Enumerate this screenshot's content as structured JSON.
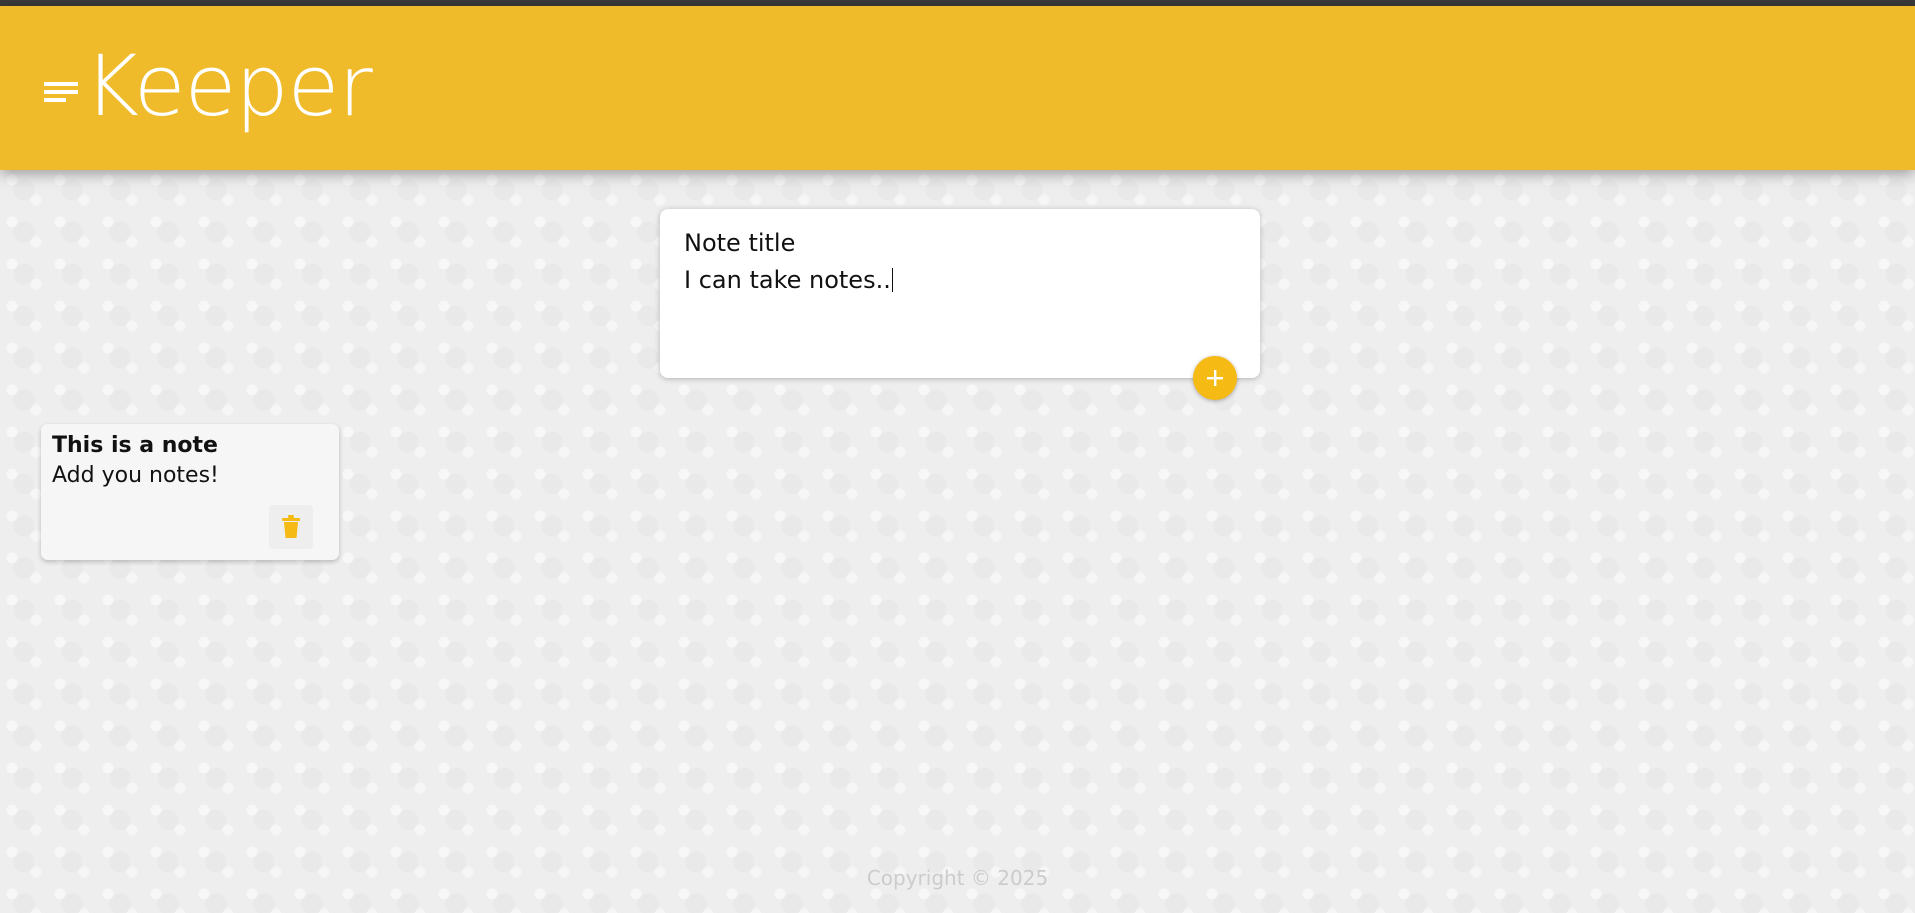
{
  "app": {
    "name": "Keeper",
    "accent_color": "#f0bb2a",
    "logo_icon": "notes-lines-icon"
  },
  "create_note": {
    "title_text": "Note title",
    "content_text": "I can take notes..",
    "add_button_icon": "plus-icon"
  },
  "notes": [
    {
      "title": "This is a note",
      "content": "Add you notes!",
      "delete_icon": "trash-icon"
    }
  ],
  "footer": {
    "copyright": "Copyright © 2025"
  }
}
